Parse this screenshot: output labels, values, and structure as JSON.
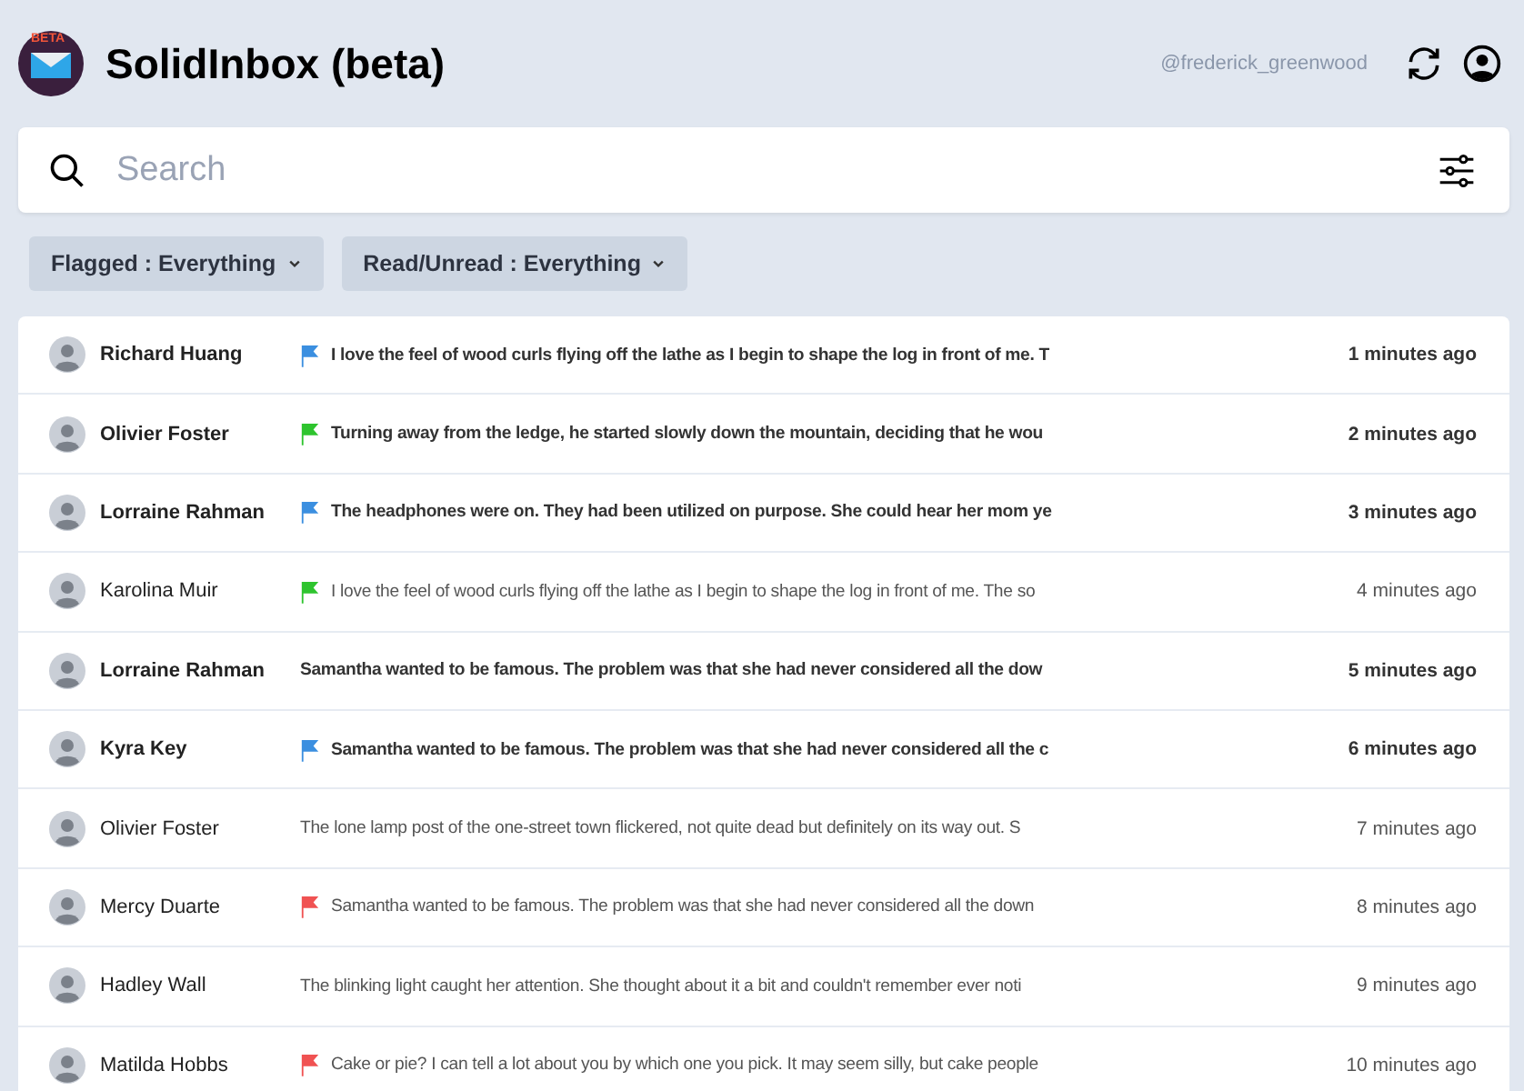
{
  "app": {
    "title": "SolidInbox (beta)",
    "logo_badge": "BETA",
    "username": "@frederick_greenwood"
  },
  "search": {
    "placeholder": "Search"
  },
  "filters": [
    {
      "label": "Flagged : Everything"
    },
    {
      "label": "Read/Unread : Everything"
    }
  ],
  "messages": [
    {
      "sender": "Richard Huang",
      "unread": true,
      "color": "#3b8fe0",
      "preview": "I love the feel of wood curls flying off the lathe as I begin to shape the log in front of me. T",
      "time": "1 minutes ago"
    },
    {
      "sender": "Olivier Foster",
      "unread": true,
      "color": "#2ec42e",
      "preview": "Turning away from the ledge, he started slowly down the mountain, deciding that he wou",
      "time": "2 minutes ago"
    },
    {
      "sender": "Lorraine Rahman",
      "unread": true,
      "color": "#3b8fe0",
      "preview": "The headphones were on. They had been utilized on purpose. She could hear her mom ye",
      "time": "3 minutes ago"
    },
    {
      "sender": "Karolina Muir",
      "unread": false,
      "color": "#2ec42e",
      "preview": "I love the feel of wood curls flying off the lathe as I begin to shape the log in front of me. The so",
      "time": "4 minutes ago"
    },
    {
      "sender": "Lorraine Rahman",
      "unread": true,
      "preview": "Samantha wanted to be famous. The problem was that she had never considered all the dow",
      "time": "5 minutes ago"
    },
    {
      "sender": "Kyra Key",
      "unread": true,
      "color": "#3b8fe0",
      "preview": "Samantha wanted to be famous. The problem was that she had never considered all the c",
      "time": "6 minutes ago"
    },
    {
      "sender": "Olivier Foster",
      "unread": false,
      "preview": "The lone lamp post of the one-street town flickered, not quite dead but definitely on its way out. S",
      "time": "7 minutes ago"
    },
    {
      "sender": "Mercy Duarte",
      "unread": false,
      "color": "#f05252",
      "preview": "Samantha wanted to be famous. The problem was that she had never considered all the down",
      "time": "8 minutes ago"
    },
    {
      "sender": "Hadley Wall",
      "unread": false,
      "preview": "The blinking light caught her attention. She thought about it a bit and couldn't remember ever noti",
      "time": "9 minutes ago"
    },
    {
      "sender": "Matilda Hobbs",
      "unread": false,
      "color": "#f05252",
      "preview": "Cake or pie? I can tell a lot about you by which one you pick. It may seem silly, but cake people",
      "time": "10 minutes ago"
    }
  ]
}
